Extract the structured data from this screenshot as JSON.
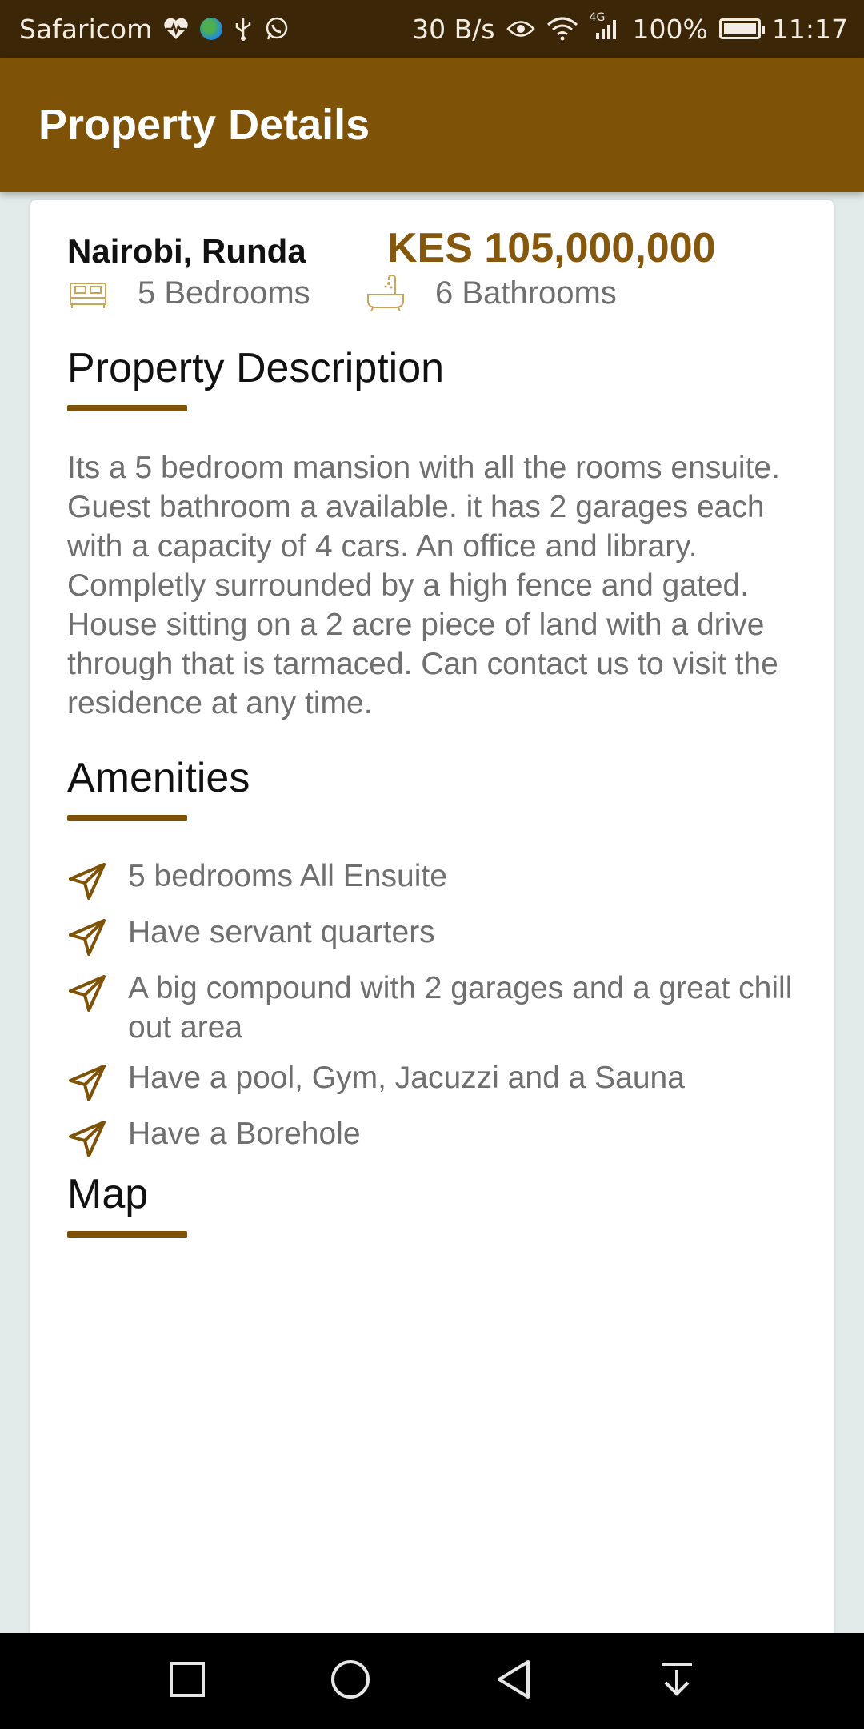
{
  "status_bar": {
    "carrier": "Safaricom",
    "speed": "30 B/s",
    "network": "4G",
    "battery": "100%",
    "time": "11:17"
  },
  "app_bar": {
    "title": "Property Details"
  },
  "property": {
    "location": "Nairobi, Runda",
    "price": "KES 105,000,000",
    "bedrooms": "5 Bedrooms",
    "bathrooms": "6 Bathrooms"
  },
  "description": {
    "title": "Property Description",
    "text": "Its a 5 bedroom mansion with all the rooms ensuite. Guest bathroom a available. it has 2 garages each with a capacity of 4 cars. An office and library. Completly surrounded by a high fence and gated. House sitting on a 2 acre piece of land with a drive through that is tarmaced. Can contact us to visit the residence at any time."
  },
  "amenities": {
    "title": "Amenities",
    "items": [
      "5 bedrooms All Ensuite",
      "Have servant quarters",
      "A big compound with 2 garages and a great chill out area",
      "Have a pool, Gym, Jacuzzi and a Sauna",
      "Have a Borehole"
    ]
  },
  "map": {
    "title": "Map"
  },
  "colors": {
    "accent": "#7e5207",
    "price": "#86580e",
    "status_bar": "#3b2607"
  },
  "icons": [
    "heart-pulse-icon",
    "globe-icon",
    "usb-icon",
    "whatsapp-icon",
    "eye-icon",
    "wifi-icon",
    "signal-icon",
    "battery-icon",
    "bed-icon",
    "bathtub-icon",
    "navigation-arrow-icon",
    "square-icon",
    "circle-icon",
    "back-triangle-icon",
    "notification-down-icon"
  ]
}
